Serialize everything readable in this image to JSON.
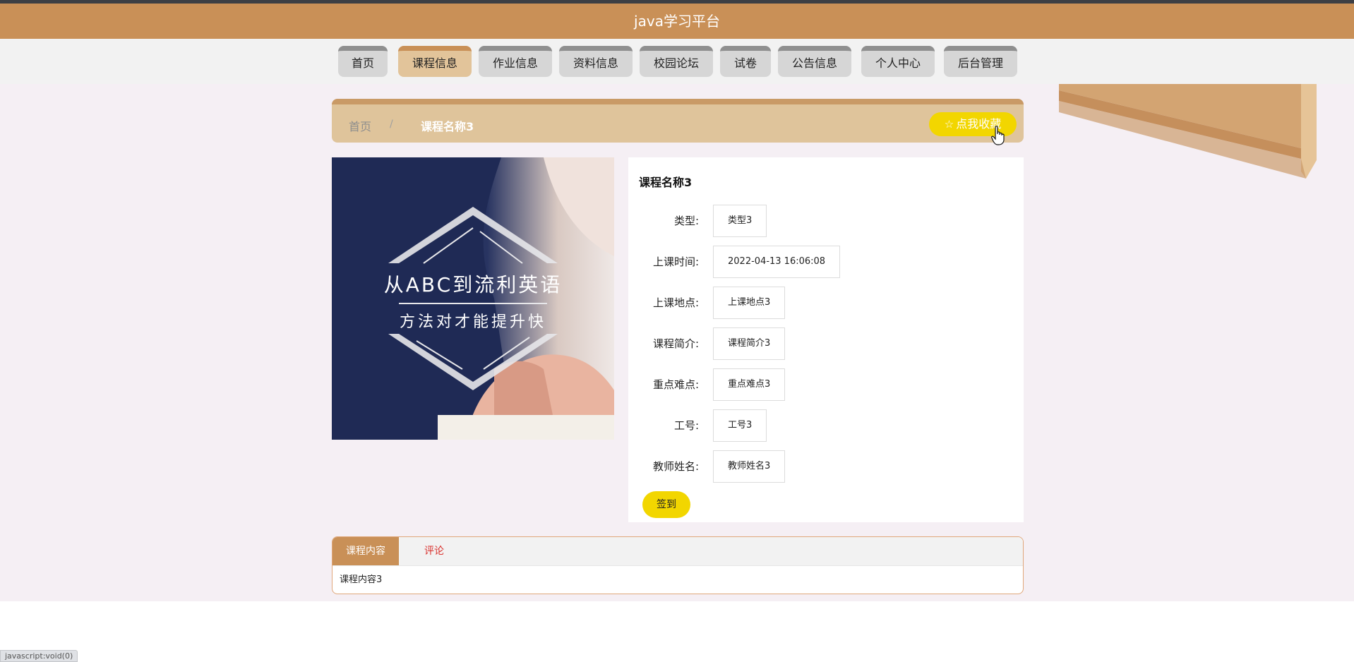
{
  "header": {
    "title": "java学习平台"
  },
  "nav": [
    {
      "label": "首页",
      "active": false
    },
    {
      "label": "课程信息",
      "active": true
    },
    {
      "label": "作业信息",
      "active": false
    },
    {
      "label": "资料信息",
      "active": false
    },
    {
      "label": "校园论坛",
      "active": false
    },
    {
      "label": "试卷",
      "active": false
    },
    {
      "label": "公告信息",
      "active": false
    },
    {
      "label": "个人中心",
      "active": false
    },
    {
      "label": "后台管理",
      "active": false
    }
  ],
  "breadcrumb": {
    "home": "首页",
    "separator": "/",
    "current": "课程名称3"
  },
  "favorite_button": {
    "label": "点我收藏",
    "icon": "star-outline-icon"
  },
  "course_image": {
    "line1": "从ABC到流利英语",
    "line2": "方法对才能提升快"
  },
  "detail": {
    "title": "课程名称3",
    "fields": [
      {
        "label": "类型:",
        "value": "类型3"
      },
      {
        "label": "上课时间:",
        "value": "2022-04-13 16:06:08"
      },
      {
        "label": "上课地点:",
        "value": "上课地点3"
      },
      {
        "label": "课程简介:",
        "value": "课程简介3"
      },
      {
        "label": "重点难点:",
        "value": "重点难点3"
      },
      {
        "label": "工号:",
        "value": "工号3"
      },
      {
        "label": "教师姓名:",
        "value": "教师姓名3"
      }
    ],
    "signin_label": "签到"
  },
  "tabs": {
    "items": [
      {
        "label": "课程内容"
      },
      {
        "label": "评论"
      }
    ],
    "content": "课程内容3"
  },
  "status_bar": {
    "text": "javascript:void(0)"
  },
  "colors": {
    "header_bg": "#c99057",
    "accent_yellow": "#f2d600",
    "comment_red": "#d9302c"
  }
}
